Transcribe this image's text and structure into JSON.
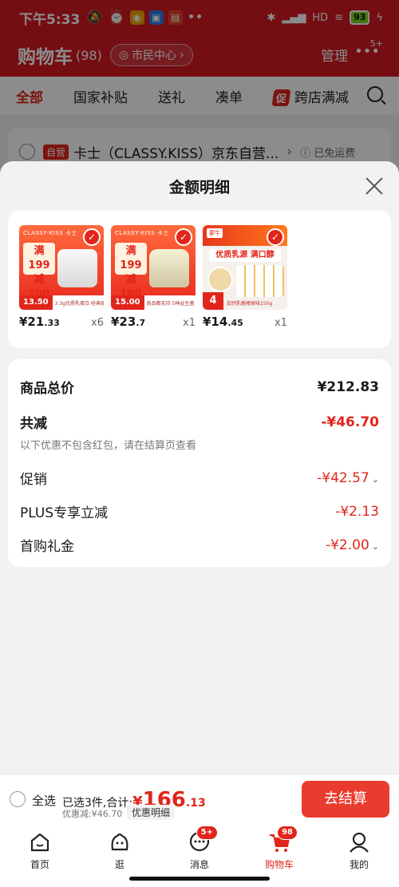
{
  "status_bar": {
    "time": "下午5:33",
    "battery": "93",
    "net": "HD"
  },
  "background": {
    "header": {
      "title": "购物车",
      "count": "(98)",
      "location": "市民中心",
      "manage": "管理",
      "more_badge": "5+"
    },
    "tabs": [
      "全部",
      "国家补贴",
      "送礼",
      "凑单",
      "跨店满减"
    ],
    "promo_tag": "促",
    "store": {
      "self_tag": "自营",
      "name": "卡士（CLASSY.KISS）京东自营...",
      "free_shipping": "已免运费"
    }
  },
  "sheet": {
    "title": "金额明细",
    "products": [
      {
        "brand": "CLASSY·KISS 卡士",
        "promo": "满199\n减100",
        "price_tag": "13.50",
        "desc": "3.3g优质乳蛋白 经典原味",
        "price_int": "¥21",
        "price_dec": ".33",
        "qty": "x6"
      },
      {
        "brand": "CLASSY·KISS 卡士",
        "promo": "满199\n减100",
        "price_tag": "15.00",
        "desc": "商品都支持 5种益生菌",
        "price_int": "¥23",
        "price_dec": ".7",
        "qty": "x1"
      },
      {
        "brand": "蒙牛",
        "headline": "优质乳源 满口醇",
        "count_tag": "4",
        "desc": "加钙乳酪棒原味250g",
        "price_int": "¥14",
        "price_dec": ".45",
        "qty": "x1"
      }
    ],
    "details": {
      "total_label": "商品总价",
      "total_value": "¥212.83",
      "reduce_label": "共减",
      "reduce_value": "-¥46.70",
      "note": "以下优惠不包含红包，请在结算页查看",
      "promo_label": "促销",
      "promo_value": "-¥42.57",
      "plus_label": "PLUS专享立减",
      "plus_value": "-¥2.13",
      "gift_label": "首购礼金",
      "gift_value": "-¥2.00"
    }
  },
  "checkout": {
    "select_all": "全选",
    "selected": "已选3件,合计:",
    "yen": "¥",
    "amount_int": "166",
    "amount_dec": ".13",
    "discount": "优惠减:¥46.70",
    "detail_btn": "优惠明细",
    "button": "去结算"
  },
  "nav": {
    "items": [
      {
        "label": "首页",
        "icon": "home-icon"
      },
      {
        "label": "逛",
        "icon": "explore-icon"
      },
      {
        "label": "消息",
        "icon": "message-icon",
        "badge": "5+"
      },
      {
        "label": "购物车",
        "icon": "cart-icon",
        "badge": "98"
      },
      {
        "label": "我的",
        "icon": "profile-icon"
      }
    ]
  },
  "colors": {
    "accent": "#e1251b",
    "header_bg": "#d31b24",
    "checkout_btn": "#ea3b2f"
  }
}
